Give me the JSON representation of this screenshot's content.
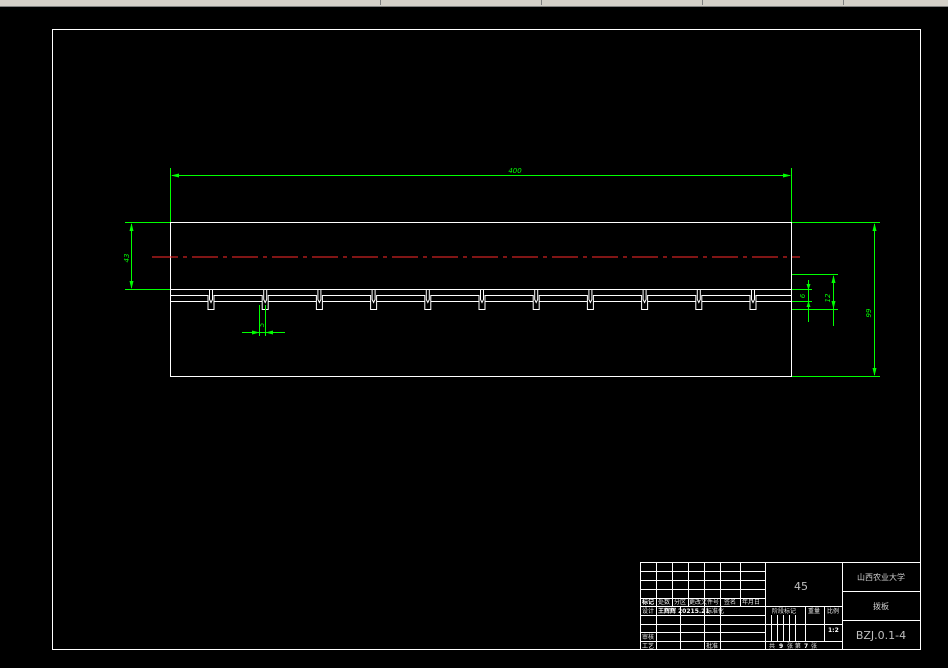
{
  "drawing": {
    "dimensions": {
      "length": "400",
      "upper_height": "43",
      "total_height": "99",
      "slot_depth": "6",
      "groove_offset": "12",
      "slot_width": "5"
    }
  },
  "title_block": {
    "university": "山西农业大学",
    "material": "45",
    "part_name": "拨板",
    "drawing_number": "BZJ.0.1-4",
    "scale": "1:2",
    "sheet_total": "9",
    "sheet_no": "7",
    "sheets_label": "共",
    "sheet_label": "张 第",
    "sheet_suffix": "张",
    "designer": "王辉辉",
    "date": "20215.21",
    "labels": {
      "mark": "标记",
      "count": "处数",
      "zone": "分区",
      "change_doc": "更改文件号",
      "signature": "签名",
      "ymd": "年月日",
      "design": "设计",
      "standardize": "标准化",
      "review": "审核",
      "process": "工艺",
      "approve": "批准",
      "stage_mark": "阶段标记",
      "weight": "重量",
      "scale_label": "比例"
    }
  },
  "colors": {
    "background": "#000000",
    "outline": "#ffffff",
    "dimension": "#00ff00",
    "centerline": "#ff2a2a"
  }
}
